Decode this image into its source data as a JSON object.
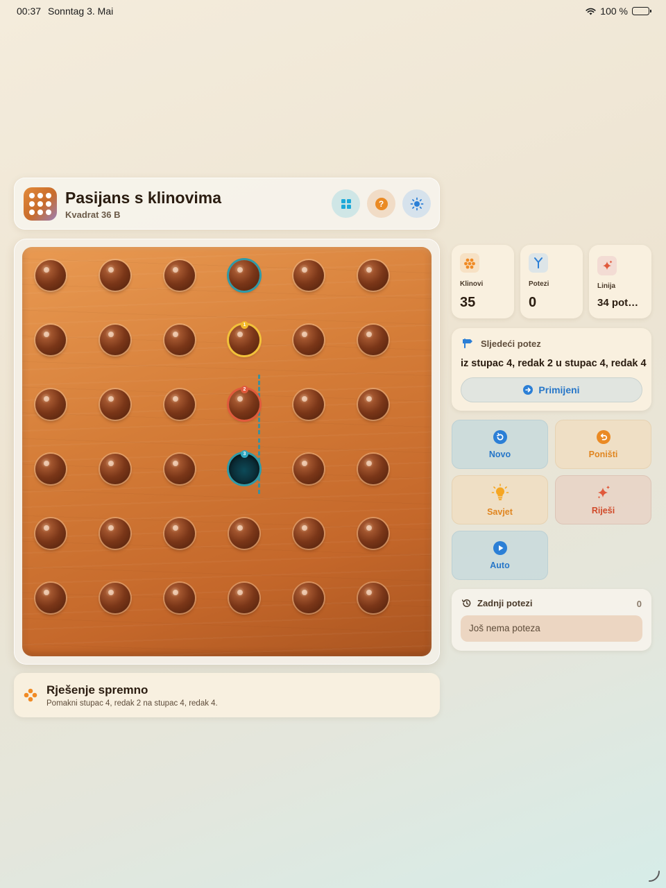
{
  "status_bar": {
    "time": "00:37",
    "date": "Sonntag 3. Mai",
    "battery": "100 %"
  },
  "header": {
    "title": "Pasijans s klinovima",
    "subtitle": "Kvadrat 36 B"
  },
  "board": {
    "rows": 6,
    "cols": 6,
    "empty_cells": [
      [
        4,
        4
      ]
    ],
    "highlight": {
      "from": [
        4,
        2
      ],
      "over": [
        4,
        3
      ],
      "to": [
        4,
        4
      ],
      "top_ring": [
        4,
        1
      ]
    },
    "move_badges": [
      "1",
      "2",
      "3"
    ],
    "colors": {
      "teal": "#2f9aa8",
      "yellow": "#f2c23a",
      "red": "#e05a3c"
    }
  },
  "status_message": {
    "title": "Rješenje spremno",
    "description": "Pomakni stupac 4, redak 2 na stupac 4, redak 4."
  },
  "stats": [
    {
      "label": "Klinovi",
      "value": "35",
      "icon": "pegs-cluster-icon"
    },
    {
      "label": "Potezi",
      "value": "0",
      "icon": "branch-icon"
    },
    {
      "label": "Linija",
      "value": "34 pot…",
      "icon": "sparkle-icon"
    }
  ],
  "next_move": {
    "heading": "Sljedeći potez",
    "text": "iz stupac 4, redak 2 u stupac 4, redak 4",
    "apply_label": "Primijeni"
  },
  "actions": {
    "new_label": "Novo",
    "undo_label": "Poništi",
    "hint_label": "Savjet",
    "solve_label": "Riješi",
    "auto_label": "Auto"
  },
  "recent_moves": {
    "heading": "Zadnji potezi",
    "count": "0",
    "empty_text": "Još nema poteza"
  }
}
